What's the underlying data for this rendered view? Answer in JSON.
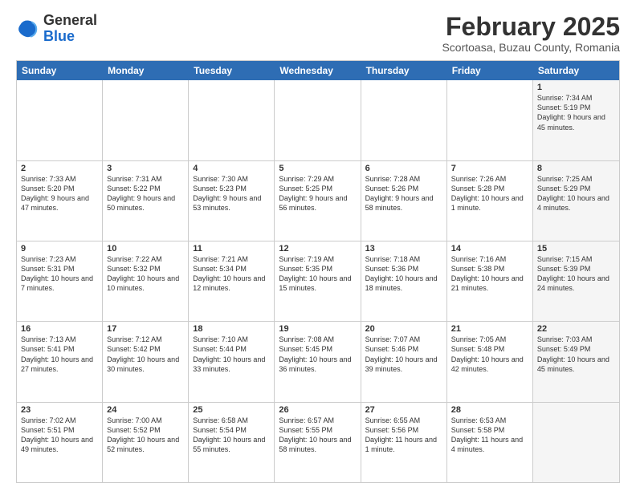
{
  "logo": {
    "general": "General",
    "blue": "Blue"
  },
  "header": {
    "month": "February 2025",
    "location": "Scortoasa, Buzau County, Romania"
  },
  "days_of_week": [
    "Sunday",
    "Monday",
    "Tuesday",
    "Wednesday",
    "Thursday",
    "Friday",
    "Saturday"
  ],
  "rows": [
    [
      {
        "num": "",
        "info": "",
        "shade": false,
        "empty": true
      },
      {
        "num": "",
        "info": "",
        "shade": false,
        "empty": true
      },
      {
        "num": "",
        "info": "",
        "shade": false,
        "empty": true
      },
      {
        "num": "",
        "info": "",
        "shade": false,
        "empty": true
      },
      {
        "num": "",
        "info": "",
        "shade": false,
        "empty": true
      },
      {
        "num": "",
        "info": "",
        "shade": false,
        "empty": true
      },
      {
        "num": "1",
        "info": "Sunrise: 7:34 AM\nSunset: 5:19 PM\nDaylight: 9 hours and 45 minutes.",
        "shade": true,
        "empty": false
      }
    ],
    [
      {
        "num": "2",
        "info": "Sunrise: 7:33 AM\nSunset: 5:20 PM\nDaylight: 9 hours and 47 minutes.",
        "shade": false,
        "empty": false
      },
      {
        "num": "3",
        "info": "Sunrise: 7:31 AM\nSunset: 5:22 PM\nDaylight: 9 hours and 50 minutes.",
        "shade": false,
        "empty": false
      },
      {
        "num": "4",
        "info": "Sunrise: 7:30 AM\nSunset: 5:23 PM\nDaylight: 9 hours and 53 minutes.",
        "shade": false,
        "empty": false
      },
      {
        "num": "5",
        "info": "Sunrise: 7:29 AM\nSunset: 5:25 PM\nDaylight: 9 hours and 56 minutes.",
        "shade": false,
        "empty": false
      },
      {
        "num": "6",
        "info": "Sunrise: 7:28 AM\nSunset: 5:26 PM\nDaylight: 9 hours and 58 minutes.",
        "shade": false,
        "empty": false
      },
      {
        "num": "7",
        "info": "Sunrise: 7:26 AM\nSunset: 5:28 PM\nDaylight: 10 hours and 1 minute.",
        "shade": false,
        "empty": false
      },
      {
        "num": "8",
        "info": "Sunrise: 7:25 AM\nSunset: 5:29 PM\nDaylight: 10 hours and 4 minutes.",
        "shade": true,
        "empty": false
      }
    ],
    [
      {
        "num": "9",
        "info": "Sunrise: 7:23 AM\nSunset: 5:31 PM\nDaylight: 10 hours and 7 minutes.",
        "shade": false,
        "empty": false
      },
      {
        "num": "10",
        "info": "Sunrise: 7:22 AM\nSunset: 5:32 PM\nDaylight: 10 hours and 10 minutes.",
        "shade": false,
        "empty": false
      },
      {
        "num": "11",
        "info": "Sunrise: 7:21 AM\nSunset: 5:34 PM\nDaylight: 10 hours and 12 minutes.",
        "shade": false,
        "empty": false
      },
      {
        "num": "12",
        "info": "Sunrise: 7:19 AM\nSunset: 5:35 PM\nDaylight: 10 hours and 15 minutes.",
        "shade": false,
        "empty": false
      },
      {
        "num": "13",
        "info": "Sunrise: 7:18 AM\nSunset: 5:36 PM\nDaylight: 10 hours and 18 minutes.",
        "shade": false,
        "empty": false
      },
      {
        "num": "14",
        "info": "Sunrise: 7:16 AM\nSunset: 5:38 PM\nDaylight: 10 hours and 21 minutes.",
        "shade": false,
        "empty": false
      },
      {
        "num": "15",
        "info": "Sunrise: 7:15 AM\nSunset: 5:39 PM\nDaylight: 10 hours and 24 minutes.",
        "shade": true,
        "empty": false
      }
    ],
    [
      {
        "num": "16",
        "info": "Sunrise: 7:13 AM\nSunset: 5:41 PM\nDaylight: 10 hours and 27 minutes.",
        "shade": false,
        "empty": false
      },
      {
        "num": "17",
        "info": "Sunrise: 7:12 AM\nSunset: 5:42 PM\nDaylight: 10 hours and 30 minutes.",
        "shade": false,
        "empty": false
      },
      {
        "num": "18",
        "info": "Sunrise: 7:10 AM\nSunset: 5:44 PM\nDaylight: 10 hours and 33 minutes.",
        "shade": false,
        "empty": false
      },
      {
        "num": "19",
        "info": "Sunrise: 7:08 AM\nSunset: 5:45 PM\nDaylight: 10 hours and 36 minutes.",
        "shade": false,
        "empty": false
      },
      {
        "num": "20",
        "info": "Sunrise: 7:07 AM\nSunset: 5:46 PM\nDaylight: 10 hours and 39 minutes.",
        "shade": false,
        "empty": false
      },
      {
        "num": "21",
        "info": "Sunrise: 7:05 AM\nSunset: 5:48 PM\nDaylight: 10 hours and 42 minutes.",
        "shade": false,
        "empty": false
      },
      {
        "num": "22",
        "info": "Sunrise: 7:03 AM\nSunset: 5:49 PM\nDaylight: 10 hours and 45 minutes.",
        "shade": true,
        "empty": false
      }
    ],
    [
      {
        "num": "23",
        "info": "Sunrise: 7:02 AM\nSunset: 5:51 PM\nDaylight: 10 hours and 49 minutes.",
        "shade": false,
        "empty": false
      },
      {
        "num": "24",
        "info": "Sunrise: 7:00 AM\nSunset: 5:52 PM\nDaylight: 10 hours and 52 minutes.",
        "shade": false,
        "empty": false
      },
      {
        "num": "25",
        "info": "Sunrise: 6:58 AM\nSunset: 5:54 PM\nDaylight: 10 hours and 55 minutes.",
        "shade": false,
        "empty": false
      },
      {
        "num": "26",
        "info": "Sunrise: 6:57 AM\nSunset: 5:55 PM\nDaylight: 10 hours and 58 minutes.",
        "shade": false,
        "empty": false
      },
      {
        "num": "27",
        "info": "Sunrise: 6:55 AM\nSunset: 5:56 PM\nDaylight: 11 hours and 1 minute.",
        "shade": false,
        "empty": false
      },
      {
        "num": "28",
        "info": "Sunrise: 6:53 AM\nSunset: 5:58 PM\nDaylight: 11 hours and 4 minutes.",
        "shade": false,
        "empty": false
      },
      {
        "num": "",
        "info": "",
        "shade": true,
        "empty": true
      }
    ]
  ]
}
